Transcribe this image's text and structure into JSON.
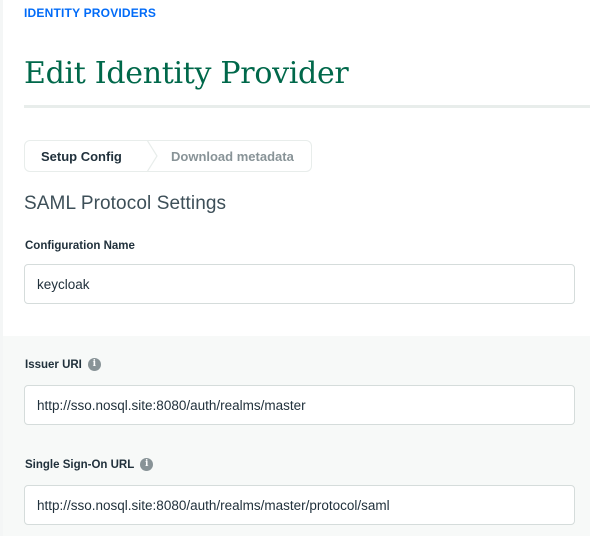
{
  "breadcrumb": "IDENTITY PROVIDERS",
  "page_title": "Edit Identity Provider",
  "stepper": {
    "steps": [
      {
        "label": "Setup Config",
        "active": true
      },
      {
        "label": "Download metadata",
        "active": false
      }
    ]
  },
  "section_title": "SAML Protocol Settings",
  "fields": {
    "configuration_name": {
      "label": "Configuration Name",
      "value": "keycloak"
    },
    "issuer_uri": {
      "label": "Issuer URI",
      "value": "http://sso.nosql.site:8080/auth/realms/master",
      "info_icon": "info-icon"
    },
    "sso_url": {
      "label": "Single Sign-On URL",
      "value": "http://sso.nosql.site:8080/auth/realms/master/protocol/saml",
      "info_icon": "info-icon"
    }
  },
  "colors": {
    "link_blue": "#016bf8",
    "title_green": "#00684a",
    "muted_gray": "#889397",
    "panel_bg": "#f7f9f8"
  }
}
